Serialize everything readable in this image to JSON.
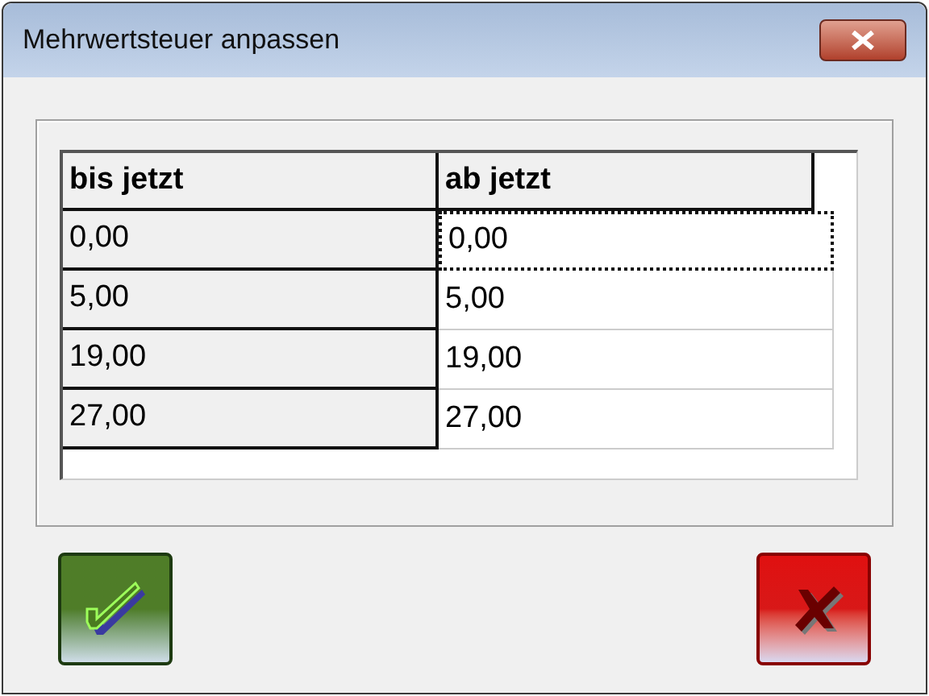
{
  "window": {
    "title": "Mehrwertsteuer anpassen"
  },
  "table": {
    "columns": [
      "bis jetzt",
      "ab jetzt"
    ],
    "rows": [
      {
        "before": "0,00",
        "after": "0,00",
        "selected": true
      },
      {
        "before": "5,00",
        "after": "5,00",
        "selected": false
      },
      {
        "before": "19,00",
        "after": "19,00",
        "selected": false
      },
      {
        "before": "27,00",
        "after": "27,00",
        "selected": false
      }
    ]
  },
  "buttons": [
    {
      "kind": "ok"
    },
    {
      "kind": "cancel"
    }
  ]
}
